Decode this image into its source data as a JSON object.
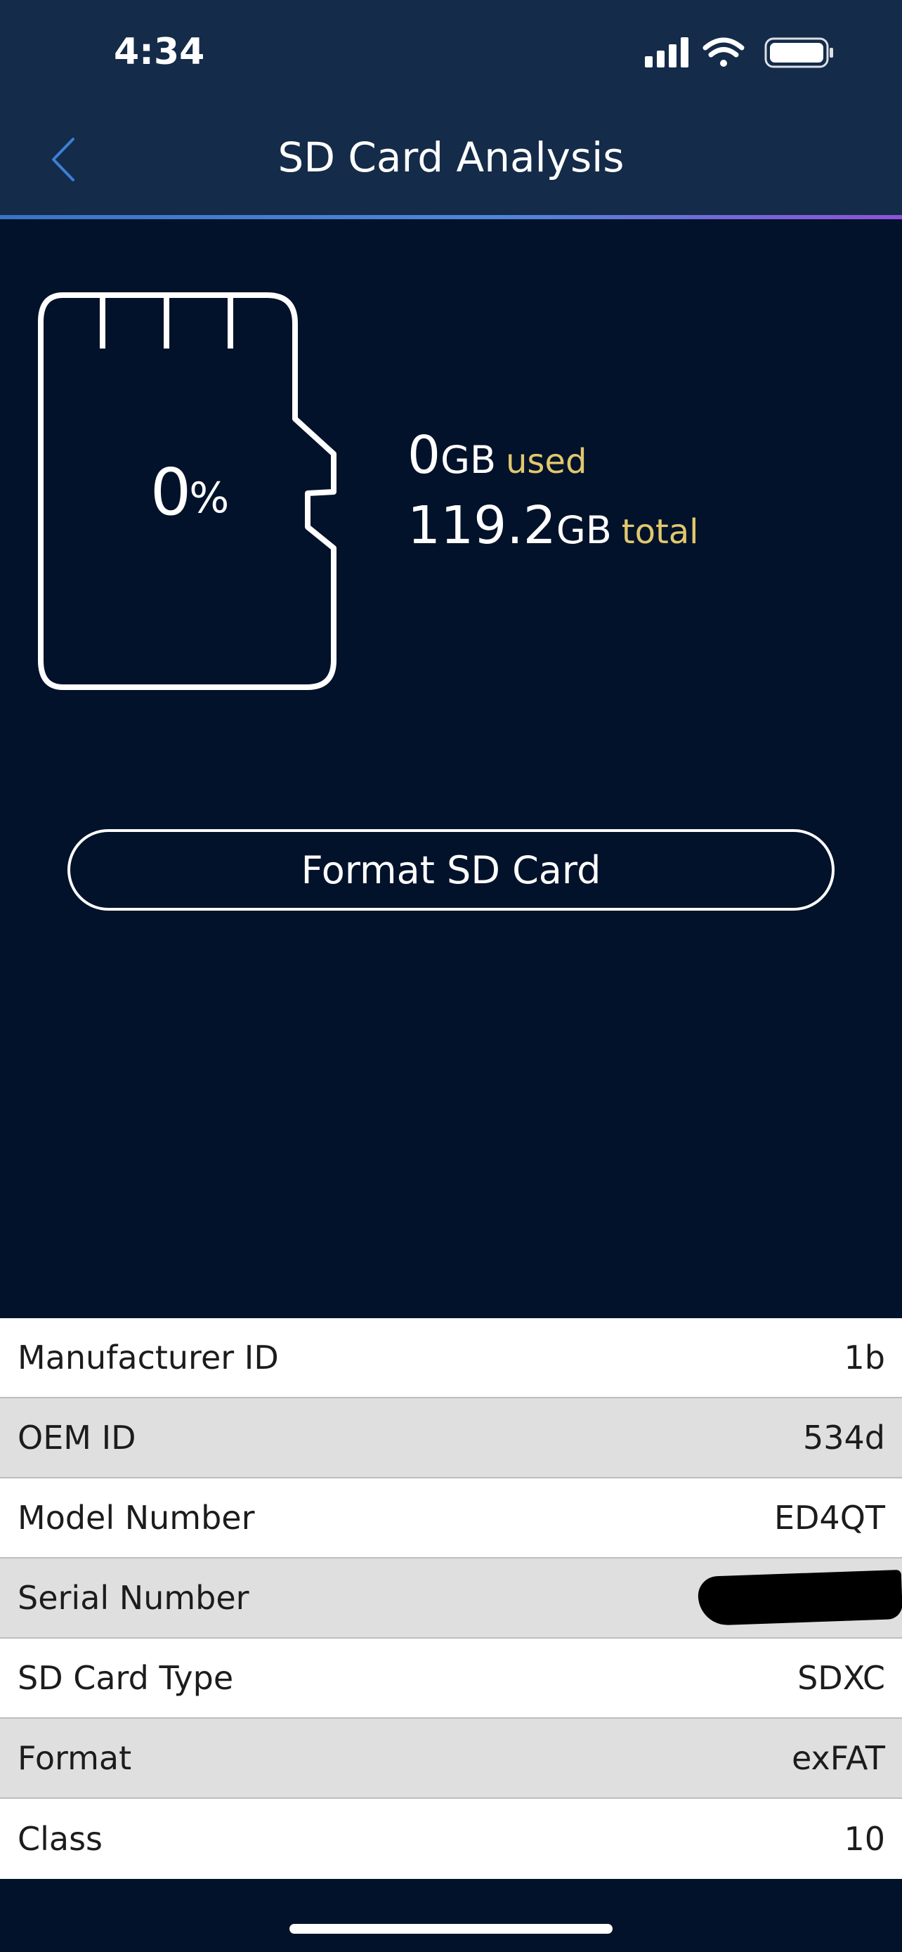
{
  "status_bar": {
    "time": "4:34",
    "icons": [
      "cellular-signal-icon",
      "wifi-icon",
      "battery-icon"
    ]
  },
  "nav": {
    "title": "SD Card Analysis",
    "back_icon": "chevron-left-icon"
  },
  "card": {
    "percent_value": "0",
    "percent_sign": "%",
    "used_value": "0",
    "used_unit": "GB",
    "used_label": "used",
    "total_value": "119.2",
    "total_unit": "GB",
    "total_label": "total"
  },
  "format_button": {
    "label": "Format SD Card"
  },
  "info": [
    {
      "label": "Manufacturer ID",
      "value": "1b"
    },
    {
      "label": "OEM ID",
      "value": "534d"
    },
    {
      "label": "Model Number",
      "value": "ED4QT"
    },
    {
      "label": "Serial Number",
      "value": "",
      "redacted": true
    },
    {
      "label": "SD Card Type",
      "value": "SDXC"
    },
    {
      "label": "Format",
      "value": "exFAT"
    },
    {
      "label": "Class",
      "value": "10"
    }
  ],
  "colors": {
    "header": "#142b49",
    "background": "#02122a",
    "accent_label": "#e1c86e",
    "back_icon": "#3d7fd6"
  }
}
